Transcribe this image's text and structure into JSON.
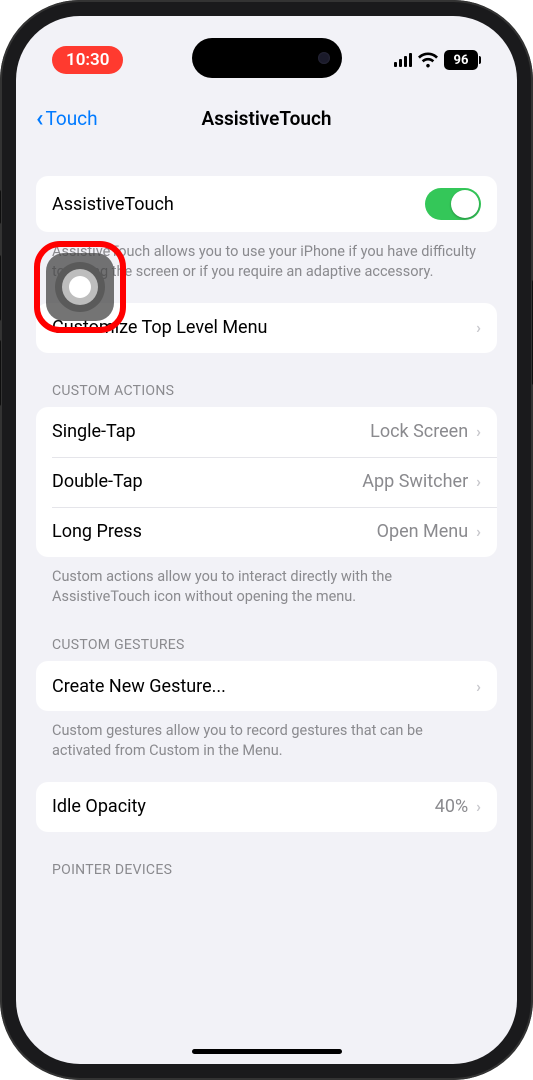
{
  "status": {
    "time": "10:30",
    "battery": "96"
  },
  "nav": {
    "back_label": "Touch",
    "title": "AssistiveTouch"
  },
  "main_toggle": {
    "label": "AssistiveTouch",
    "on": true,
    "description": "AssistiveTouch allows you to use your iPhone if you have difficulty touching the screen or if you require an adaptive accessory."
  },
  "customize": {
    "label": "Customize Top Level Menu"
  },
  "custom_actions": {
    "header": "CUSTOM ACTIONS",
    "rows": [
      {
        "label": "Single-Tap",
        "value": "Lock Screen"
      },
      {
        "label": "Double-Tap",
        "value": "App Switcher"
      },
      {
        "label": "Long Press",
        "value": "Open Menu"
      }
    ],
    "footer": "Custom actions allow you to interact directly with the AssistiveTouch icon without opening the menu."
  },
  "custom_gestures": {
    "header": "CUSTOM GESTURES",
    "create_label": "Create New Gesture...",
    "footer": "Custom gestures allow you to record gestures that can be activated from Custom in the Menu."
  },
  "idle_opacity": {
    "label": "Idle Opacity",
    "value": "40%"
  },
  "pointer_devices": {
    "header": "POINTER DEVICES"
  }
}
